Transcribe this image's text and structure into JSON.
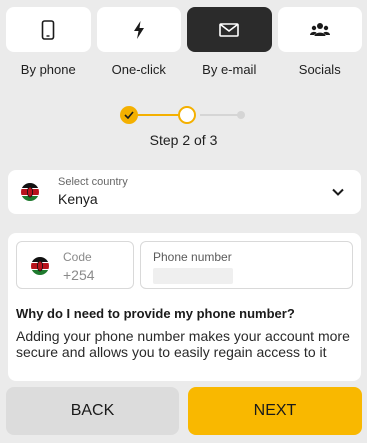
{
  "tabs": [
    {
      "label": "By phone",
      "icon": "smartphone-icon",
      "active": false
    },
    {
      "label": "One-click",
      "icon": "lightning-icon",
      "active": false
    },
    {
      "label": "By e-mail",
      "icon": "envelope-icon",
      "active": true
    },
    {
      "label": "Socials",
      "icon": "users-icon",
      "active": false
    }
  ],
  "stepper": {
    "current": 2,
    "total": 3,
    "text": "Step 2 of 3"
  },
  "country": {
    "label": "Select country",
    "value": "Kenya",
    "flag": "kenya-flag-icon"
  },
  "phone": {
    "code_label": "Code",
    "code_value": "+254",
    "number_label": "Phone number",
    "number_value": ""
  },
  "info": {
    "title": "Why do I need to provide my phone number?",
    "text": "Adding your phone number makes your account more secure and allows you to easily regain access to it"
  },
  "buttons": {
    "back": "BACK",
    "next": "NEXT"
  },
  "colors": {
    "accent": "#f9b800",
    "active_tab": "#2b2b2b",
    "background": "#ebebeb"
  }
}
